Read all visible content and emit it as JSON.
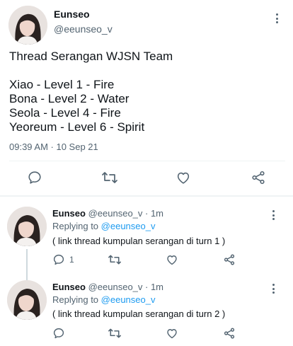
{
  "main_tweet": {
    "name": "Eunseo",
    "handle": "@eeunseo_v",
    "lines": [
      "Thread Serangan WJSN Team",
      "",
      "Xiao - Level 1 - Fire",
      "Bona - Level 2 - Water",
      "Seola - Level 4 - Fire",
      "Yeoreum - Level 6 - Spirit"
    ],
    "timestamp": "09:39 AM · 10 Sep 21",
    "actions": {
      "reply_icon": "reply-icon",
      "retweet_icon": "retweet-icon",
      "like_icon": "heart-icon",
      "share_icon": "share-icon"
    }
  },
  "replies": [
    {
      "name": "Eunseo",
      "handle_time": "@eeunseo_v · 1m",
      "replying_prefix": "Replying to",
      "replying_to": "@eeunseo_v",
      "text": "( link thread kumpulan serangan di turn 1 )",
      "reply_count": "1"
    },
    {
      "name": "Eunseo",
      "handle_time": "@eeunseo_v · 1m",
      "replying_prefix": "Replying to",
      "replying_to": "@eeunseo_v",
      "text": "( link thread kumpulan serangan di turn 2 )",
      "reply_count": ""
    }
  ],
  "colors": {
    "text": "#0f1419",
    "secondary": "#536471",
    "link": "#1d9bf0",
    "divider": "#eff3f4"
  }
}
